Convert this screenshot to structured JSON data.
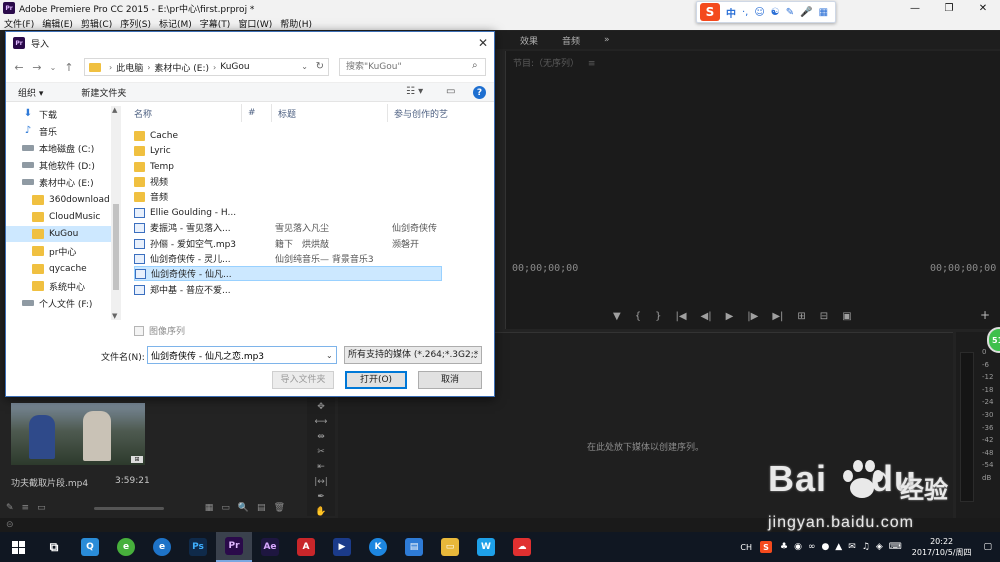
{
  "app": {
    "title": "Adobe Premiere Pro CC 2015 - E:\\pr中心\\first.prproj *",
    "icon_text": "Pr",
    "menu": [
      "文件(F)",
      "编辑(E)",
      "剪辑(C)",
      "序列(S)",
      "标记(M)",
      "字幕(T)",
      "窗口(W)",
      "帮助(H)"
    ],
    "window_controls": [
      "—",
      "❐",
      "✕"
    ]
  },
  "ime_toolbar": {
    "logo": "S",
    "mode": "中",
    "icons": [
      "·,",
      "☺",
      "☯",
      "✎",
      "🎤",
      "▦"
    ]
  },
  "premiere": {
    "top_tabs": [
      "效果",
      "音频",
      "»"
    ],
    "program_label": "节目:（无序列）",
    "program_menu": "≡",
    "timecode_left": "00;00;00;00",
    "timecode_right": "00;00;00;00",
    "transport_icons": [
      "▼",
      "{",
      "}",
      "|◀",
      "◀|",
      "▶",
      "|▶",
      "▶|",
      "⊞",
      "⊟",
      "▣"
    ],
    "add_button": "+",
    "sequence_hint": "在此处放下媒体以创建序列。",
    "tools": [
      "✥",
      "⟷",
      "⇹",
      "✂",
      "⇤",
      "|↔|",
      "✒",
      "✋"
    ],
    "meter_scale": [
      "0",
      "-6",
      "-12",
      "-18",
      "-24",
      "-30",
      "-36",
      "-42",
      "-48",
      "-54",
      "dB"
    ],
    "badge": "51",
    "clip": {
      "name": "功夫截取片段.mp4",
      "duration": "3:59:21",
      "badge": "⊞"
    },
    "project_toolbar_left": [
      "✎",
      "≡",
      "▭"
    ],
    "project_toolbar_right": [
      "▦",
      "▭",
      "🔍",
      "▤",
      "🗑"
    ],
    "status_icon": "⊝"
  },
  "watermark": {
    "brand": "Bai",
    "brand2": "du",
    "jingyan": "经验",
    "url": "jingyan.baidu.com"
  },
  "dialog": {
    "title": "导入",
    "icon_text": "Pr",
    "close": "✕",
    "nav": {
      "back": "←",
      "forward": "→",
      "dropdown": "⌄",
      "up": "↑"
    },
    "breadcrumbs": [
      "此电脑",
      "素材中心 (E:)",
      "KuGou"
    ],
    "search_placeholder": "搜索\"KuGou\"",
    "search_icon": "⌕",
    "address_dropdown": "⌄",
    "refresh": "↻",
    "commands": {
      "organize": "组织 ▾",
      "new_folder": "新建文件夹",
      "view": "☷ ▾",
      "pane": "▭",
      "help": "?"
    },
    "nav_pane": [
      {
        "label": "下载",
        "icon": "dl",
        "selected": false,
        "chevron": ""
      },
      {
        "label": "音乐",
        "icon": "music",
        "selected": false,
        "chevron": ""
      },
      {
        "label": "本地磁盘 (C:)",
        "icon": "drive",
        "selected": false,
        "chevron": ">"
      },
      {
        "label": "其他软件 (D:)",
        "icon": "drive",
        "selected": false,
        "chevron": ">"
      },
      {
        "label": "素材中心 (E:)",
        "icon": "drive",
        "selected": false,
        "chevron": "⌄"
      },
      {
        "label": "360download",
        "icon": "fold",
        "selected": false,
        "chevron": ""
      },
      {
        "label": "CloudMusic",
        "icon": "fold",
        "selected": false,
        "chevron": ""
      },
      {
        "label": "KuGou",
        "icon": "fold",
        "selected": true,
        "chevron": ""
      },
      {
        "label": "pr中心",
        "icon": "fold",
        "selected": false,
        "chevron": ""
      },
      {
        "label": "qycache",
        "icon": "fold",
        "selected": false,
        "chevron": ""
      },
      {
        "label": "系统中心",
        "icon": "fold",
        "selected": false,
        "chevron": ""
      },
      {
        "label": "个人文件 (F:)",
        "icon": "drive",
        "selected": false,
        "chevron": ">"
      }
    ],
    "nav_scroll": {
      "up": "▲",
      "down": "▼"
    },
    "columns": [
      "名称",
      "#",
      "标题",
      "参与创作的艺"
    ],
    "sort_caret": "^",
    "files": [
      {
        "name": "Cache",
        "type": "folder",
        "title": "",
        "artist": "",
        "selected": false
      },
      {
        "name": "Lyric",
        "type": "folder",
        "title": "",
        "artist": "",
        "selected": false
      },
      {
        "name": "Temp",
        "type": "folder",
        "title": "",
        "artist": "",
        "selected": false
      },
      {
        "name": "视频",
        "type": "folder",
        "title": "",
        "artist": "",
        "selected": false
      },
      {
        "name": "音频",
        "type": "folder",
        "title": "",
        "artist": "",
        "selected": false
      },
      {
        "name": "Ellie Goulding - H...",
        "type": "audio",
        "title": "",
        "artist": "",
        "selected": false
      },
      {
        "name": "麦振鸿 - 雪见落入...",
        "type": "audio",
        "title": "雪见落入凡尘",
        "artist": "仙剑奇侠传",
        "selected": false
      },
      {
        "name": "孙俪 - 爱如空气.mp3",
        "type": "audio",
        "title": "籍下　烘烘敲",
        "artist": "濒磐开",
        "selected": false
      },
      {
        "name": "仙剑奇侠传 - 灵儿...",
        "type": "audio",
        "title": "仙剑纯音乐— 背景音乐3",
        "artist": "",
        "selected": false
      },
      {
        "name": "仙剑奇侠传 - 仙凡...",
        "type": "audio",
        "title": "",
        "artist": "",
        "selected": true
      },
      {
        "name": "郑中基 - 普应不爱...",
        "type": "audio",
        "title": "",
        "artist": "",
        "selected": false
      }
    ],
    "image_sequence": "图像序列",
    "filename_label": "文件名(N):",
    "filename_value": "仙剑奇侠传 - 仙凡之恋.mp3",
    "filetype_value": "所有支持的媒体 (*.264;*.3G2;*",
    "dropdown_caret": "⌄",
    "buttons": {
      "import_folder": "导入文件夹",
      "open": "打开(O)",
      "cancel": "取消"
    }
  },
  "taskbar": {
    "apps": [
      {
        "name": "task-view",
        "label": "⧉",
        "color": "#101722"
      },
      {
        "name": "app-blue",
        "label": "Q",
        "color": "#2a8cd8"
      },
      {
        "name": "app-360",
        "label": "e",
        "color": "#47b03c"
      },
      {
        "name": "app-ie",
        "label": "e",
        "color": "#1e73c8"
      },
      {
        "name": "app-photoshop",
        "label": "Ps",
        "color": "#0f2a4a"
      },
      {
        "name": "app-premiere",
        "label": "Pr",
        "color": "#2a0a4a"
      },
      {
        "name": "app-aftereffects",
        "label": "Ae",
        "color": "#1e1640"
      },
      {
        "name": "app-acrobat",
        "label": "A",
        "color": "#c8262a"
      },
      {
        "name": "app-media",
        "label": "▶",
        "color": "#1b3b8a"
      },
      {
        "name": "app-kugou",
        "label": "K",
        "color": "#1d86e0"
      },
      {
        "name": "app-docs",
        "label": "▤",
        "color": "#2e7bd6"
      },
      {
        "name": "app-folder",
        "label": "▭",
        "color": "#e8b83a"
      },
      {
        "name": "app-wps",
        "label": "W",
        "color": "#1ea0e8"
      },
      {
        "name": "app-cloud",
        "label": "☁",
        "color": "#e03030"
      }
    ],
    "tray_lang": "CH",
    "tray_ime": "S",
    "tray_icons": [
      "♣",
      "◉",
      "∞",
      "●",
      "▲",
      "✉",
      "♫",
      "◈",
      "⌨"
    ],
    "time": "20:22",
    "date": "2017/10/5/周四",
    "notification": "▢"
  }
}
